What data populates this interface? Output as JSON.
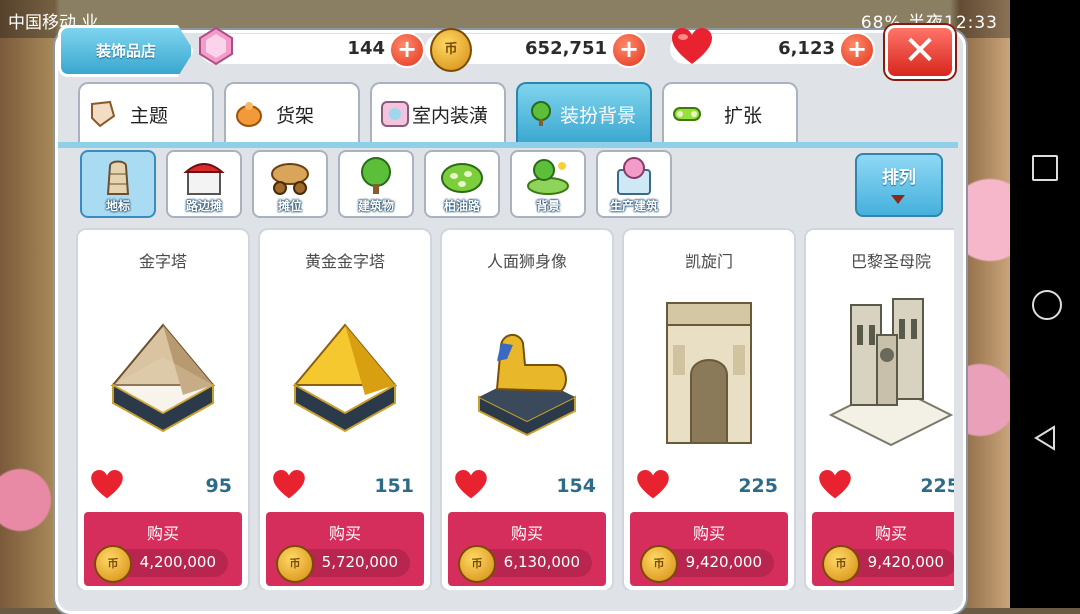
{
  "status_bar": {
    "carrier": "中国移动 业",
    "right": "68%  半夜12:33"
  },
  "shop": {
    "title": "装饰品店"
  },
  "currency": {
    "gems": "144",
    "coins": "652,751",
    "hearts": "6,123",
    "plus": "+",
    "coin_mark": "币"
  },
  "close": {
    "label": "✕"
  },
  "tabs": [
    {
      "label": "主题",
      "icon": "theme-icon"
    },
    {
      "label": "货架",
      "icon": "shelf-icon"
    },
    {
      "label": "室内装潢",
      "icon": "interior-icon"
    },
    {
      "label": "装扮背景",
      "icon": "tree-icon",
      "active": true
    },
    {
      "label": "扩张",
      "icon": "expand-icon"
    }
  ],
  "categories": [
    {
      "label": "地标",
      "icon": "landmark-icon",
      "active": true
    },
    {
      "label": "路边摊",
      "icon": "stall-icon"
    },
    {
      "label": "摊位",
      "icon": "cart-icon"
    },
    {
      "label": "建筑物",
      "icon": "building-tree-icon"
    },
    {
      "label": "柏油路",
      "icon": "road-icon"
    },
    {
      "label": "背景",
      "icon": "background-icon"
    },
    {
      "label": "生产建筑",
      "icon": "production-icon"
    }
  ],
  "sort": {
    "label": "排列"
  },
  "items": [
    {
      "name": "金字塔",
      "likes": "95",
      "buy_label": "购买",
      "price": "4,200,000",
      "art": "pyramid-icon"
    },
    {
      "name": "黄金金字塔",
      "likes": "151",
      "buy_label": "购买",
      "price": "5,720,000",
      "art": "golden-pyramid-icon"
    },
    {
      "name": "人面狮身像",
      "likes": "154",
      "buy_label": "购买",
      "price": "6,130,000",
      "art": "sphinx-icon"
    },
    {
      "name": "凯旋门",
      "likes": "225",
      "buy_label": "购买",
      "price": "9,420,000",
      "art": "arc-de-triomphe-icon"
    },
    {
      "name": "巴黎圣母院",
      "likes": "225",
      "buy_label": "购买",
      "price": "9,420,000",
      "art": "notre-dame-icon"
    }
  ],
  "colors": {
    "accent": "#3aa7cf",
    "buy": "#d62e5c",
    "close": "#d7261d"
  }
}
